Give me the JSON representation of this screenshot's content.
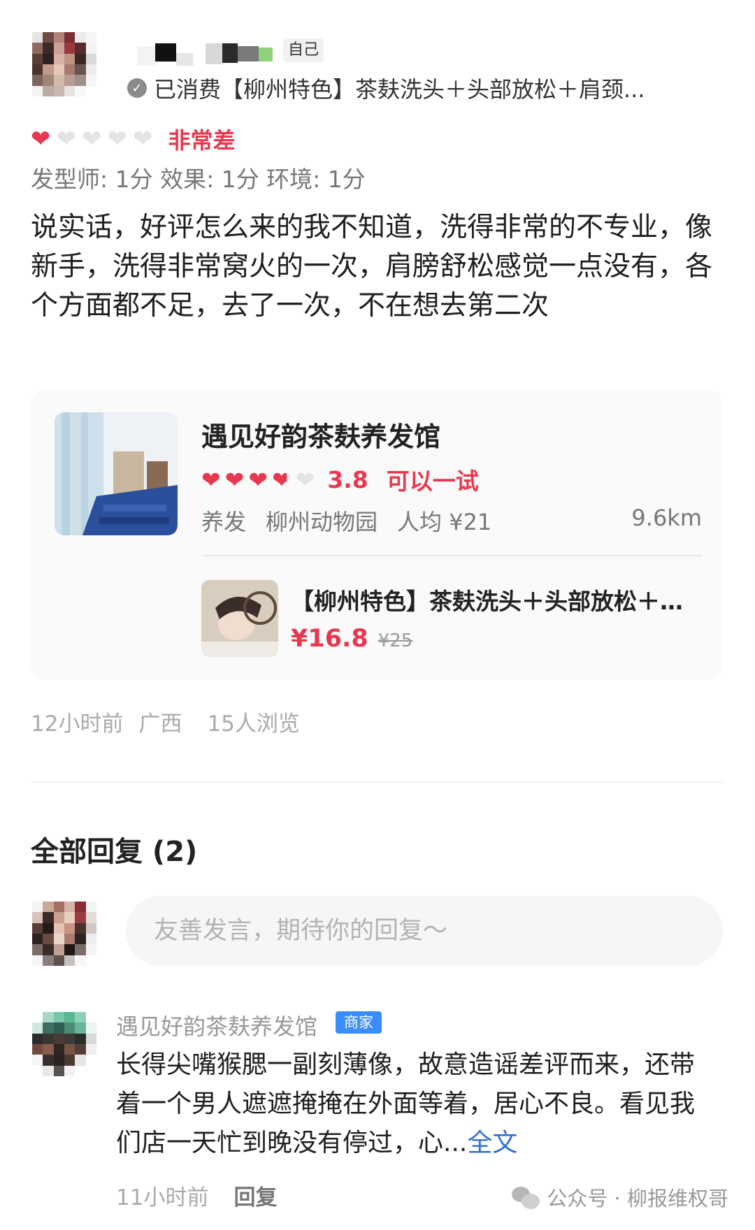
{
  "header": {
    "self_tag": "自己",
    "consumed_text": "已消费【柳州特色】茶麸洗头＋头部放松＋肩颈..."
  },
  "rating": {
    "hearts_filled": 1,
    "hearts_total": 5,
    "label": "非常差",
    "scores_text": "发型师: 1分  效果: 1分  环境: 1分"
  },
  "review": {
    "text": "说实话，好评怎么来的我不知道，洗得非常的不专业，像新手，洗得非常窝火的一次，肩膀舒松感觉一点没有，各个方面都不足，去了一次，不在想去第二次"
  },
  "shop": {
    "name": "遇见好韵茶麸养发馆",
    "hearts_filled": 3.8,
    "hearts_total": 5,
    "score": "3.8",
    "verdict": "可以一试",
    "category": "养发",
    "area": "柳州动物园",
    "per_capita": "人均 ¥21",
    "distance": "9.6km",
    "deal": {
      "title": "【柳州特色】茶麸洗头＋头部放松＋肩...",
      "price": "¥16.8",
      "original_price": "¥25"
    }
  },
  "post_meta": {
    "time": "12小时前",
    "region": "广西",
    "views": "15人浏览"
  },
  "replies": {
    "title": "全部回复 (2)",
    "input_placeholder": "友善发言，期待你的回复～",
    "items": [
      {
        "name": "遇见好韵茶麸养发馆",
        "badge": "商家",
        "text": "长得尖嘴猴腮一副刻薄像，故意造谣差评而来，还带着一个男人遮遮掩掩在外面等着，居心不良。看见我们店一天忙到晚没有停过，心...",
        "more": "全文",
        "time": "11小时前",
        "reply_label": "回复"
      }
    ]
  },
  "watermark": {
    "text": "公众号 · 柳报维权哥"
  },
  "colors": {
    "accent_red": "#e8384f",
    "link_blue": "#2f6fd6",
    "badge_blue": "#3a8dff"
  }
}
